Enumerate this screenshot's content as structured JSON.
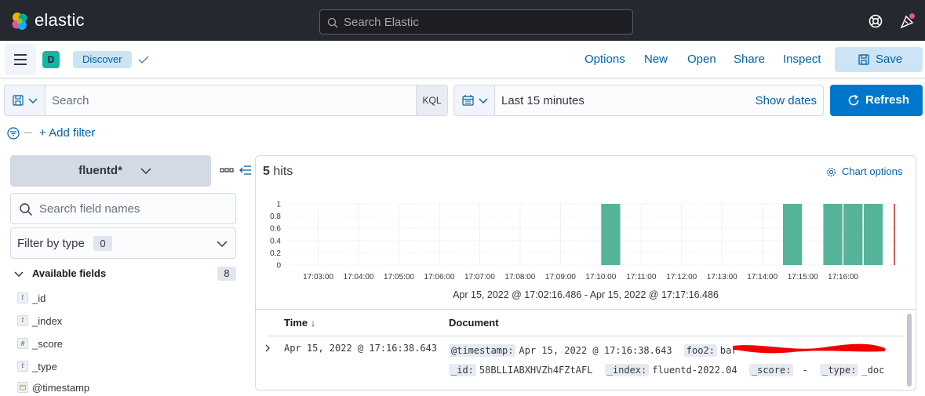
{
  "header": {
    "logo_text": "elastic",
    "search_placeholder": "Search Elastic"
  },
  "appbar": {
    "space_initial": "D",
    "breadcrumb": "Discover",
    "links": [
      "Options",
      "New",
      "Open",
      "Share",
      "Inspect"
    ],
    "save_label": "Save"
  },
  "query": {
    "placeholder": "Search",
    "language": "KQL",
    "time_range": "Last 15 minutes",
    "show_dates": "Show dates",
    "refresh_label": "Refresh",
    "add_filter": "+ Add filter"
  },
  "sidebar": {
    "index_pattern": "fluentd*",
    "field_search_placeholder": "Search field names",
    "filter_by_type": "Filter by type",
    "filter_count": "0",
    "available_label": "Available fields",
    "available_count": "8",
    "fields": [
      {
        "name": "_id",
        "type": "t"
      },
      {
        "name": "_index",
        "type": "t"
      },
      {
        "name": "_score",
        "type": "#"
      },
      {
        "name": "_type",
        "type": "t"
      },
      {
        "name": "@timestamp",
        "type": "date"
      }
    ]
  },
  "results": {
    "hit_count": "5",
    "hit_word": "hits",
    "chart_options": "Chart options",
    "range_label": "Apr 15, 2022 @ 17:02:16.486 - Apr 15, 2022 @ 17:17:16.486",
    "col_time": "Time",
    "col_doc": "Document",
    "rows": [
      {
        "time": "Apr 15, 2022 @ 17:16:38.643",
        "line1": [
          {
            "k": "@timestamp:",
            "v": "Apr 15, 2022 @ 17:16:38.643"
          },
          {
            "k": "foo2:",
            "v": "bar"
          }
        ],
        "line2": [
          {
            "k": "_id:",
            "v": "58BLLIABXHVZh4FZtAFL"
          },
          {
            "k": "_index:",
            "v": "fluentd-2022.04"
          },
          {
            "k": "_score:",
            "v": " -"
          },
          {
            "k": "_type:",
            "v": "_doc"
          }
        ]
      }
    ]
  },
  "chart_data": {
    "type": "bar",
    "y_ticks": [
      "1",
      "0.8",
      "0.6",
      "0.4",
      "0.2",
      "0"
    ],
    "ylim": [
      0,
      1
    ],
    "x_ticks": [
      "17:03:00",
      "17:04:00",
      "17:05:00",
      "17:06:00",
      "17:07:00",
      "17:08:00",
      "17:09:00",
      "17:10:00",
      "17:11:00",
      "17:12:00",
      "17:13:00",
      "17:14:00",
      "17:15:00",
      "17:16:00"
    ],
    "x_minutes_domain": [
      2.27,
      17.27
    ],
    "bars": [
      {
        "start": "17:10:00",
        "count": 1
      },
      {
        "start": "17:14:30",
        "count": 1
      },
      {
        "start": "17:15:30",
        "count": 1
      },
      {
        "start": "17:16:00",
        "count": 1
      },
      {
        "start": "17:16:30",
        "count": 1
      }
    ],
    "bar_width_minutes": 0.5,
    "bar_color": "#54b399",
    "now_marker_color": "#bd271e",
    "grid": true
  }
}
